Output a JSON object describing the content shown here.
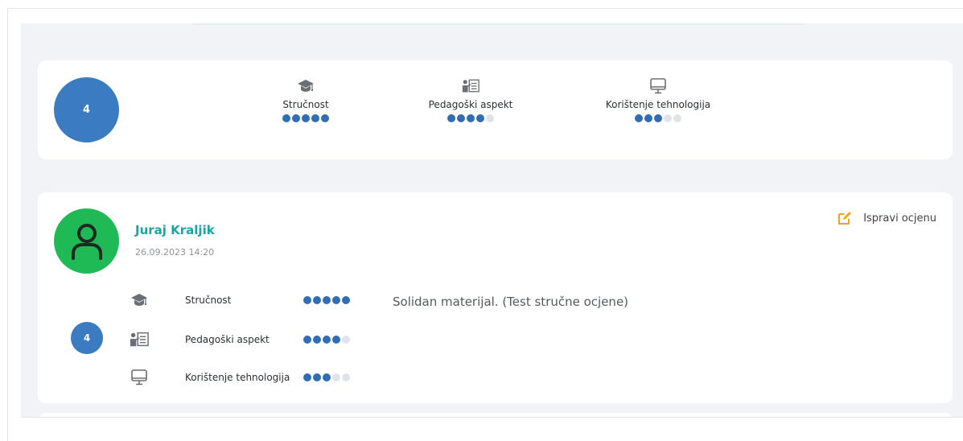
{
  "summary": {
    "overall_score": "4",
    "criteria": [
      {
        "label": "Stručnost",
        "icon": "graduation-cap-icon",
        "rating": 5,
        "max": 5
      },
      {
        "label": "Pedagoški aspekt",
        "icon": "teacher-board-icon",
        "rating": 4,
        "max": 5
      },
      {
        "label": "Korištenje tehnologija",
        "icon": "monitor-icon",
        "rating": 3,
        "max": 5
      }
    ]
  },
  "review": {
    "reviewer_name": "Juraj Kraljik",
    "date": "26.09.2023 14:20",
    "edit_label": "Ispravi ocjenu",
    "score": "4",
    "comment": "Solidan materijal. (Test stručne ocjene)",
    "ratings": [
      {
        "label": "Stručnost",
        "icon": "graduation-cap-icon",
        "rating": 5,
        "max": 5
      },
      {
        "label": "Pedagoški aspekt",
        "icon": "teacher-board-icon",
        "rating": 4,
        "max": 5
      },
      {
        "label": "Korištenje tehnologija",
        "icon": "monitor-icon",
        "rating": 3,
        "max": 5
      }
    ]
  },
  "colors": {
    "score_circle": "#3a7bc1",
    "dot_filled": "#2f6db5",
    "dot_empty": "#e0e4ea",
    "avatar": "#1fb956",
    "reviewer_name": "#1aa4a4",
    "edit_icon": "#f5a020"
  }
}
